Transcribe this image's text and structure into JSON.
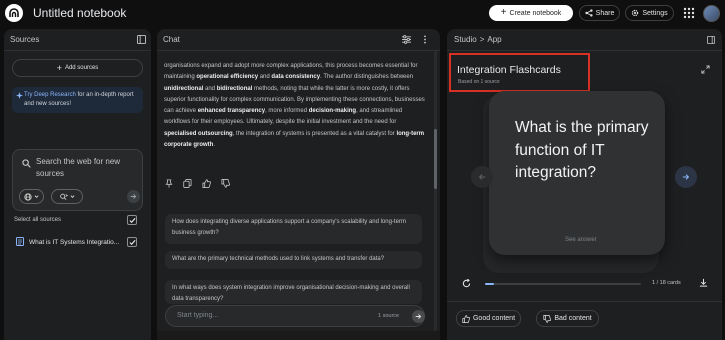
{
  "header": {
    "notebook_title": "Untitled notebook",
    "create_label": "Create notebook",
    "share_label": "Share",
    "settings_label": "Settings"
  },
  "sources": {
    "title": "Sources",
    "add_label": "Add sources",
    "deep_research_link": "Try Deep Research",
    "deep_research_text": " for an in-depth report and new sources!",
    "search_placeholder": "Search the web for new sources",
    "select_all_label": "Select all sources",
    "items": [
      {
        "label": "What is IT Systems Integratio...",
        "checked": true
      }
    ]
  },
  "chat": {
    "title": "Chat",
    "message": [
      {
        "text": "organisations expand and adopt more complex applications, this process becomes essential for maintaining ",
        "bold": false
      },
      {
        "text": "operational efficiency",
        "bold": true
      },
      {
        "text": " and ",
        "bold": false
      },
      {
        "text": "data consistency",
        "bold": true
      },
      {
        "text": ". The author distinguishes between ",
        "bold": false
      },
      {
        "text": "unidirectional",
        "bold": true
      },
      {
        "text": " and ",
        "bold": false
      },
      {
        "text": "bidirectional",
        "bold": true
      },
      {
        "text": " methods, noting that while the latter is more costly, it offers superior functionality for complex communication. By implementing these connections, businesses can achieve ",
        "bold": false
      },
      {
        "text": "enhanced transparency",
        "bold": true
      },
      {
        "text": ", more informed ",
        "bold": false
      },
      {
        "text": "decision-making",
        "bold": true
      },
      {
        "text": ", and streamlined workflows for their employees. Ultimately, despite the initial investment and the need for ",
        "bold": false
      },
      {
        "text": "specialised outsourcing",
        "bold": true
      },
      {
        "text": ", the integration of systems is presented as a vital catalyst for ",
        "bold": false
      },
      {
        "text": "long-term corporate growth",
        "bold": true
      },
      {
        "text": ".",
        "bold": false
      }
    ],
    "suggestions": [
      "How does integrating diverse applications support a company's scalability and long-term business growth?",
      "What are the primary technical methods used to link systems and transfer data?",
      "In what ways does system integration improve organisational decision-making and overall data transparency?"
    ],
    "input_placeholder": "Start typing...",
    "source_count": "1 source"
  },
  "studio": {
    "crumb_root": "Studio",
    "crumb_sep": ">",
    "crumb_leaf": "App",
    "flashcards_title": "Integration Flashcards",
    "based_on": "Based on 1 source",
    "question": "What is the primary function of IT integration?",
    "see_answer": "See answer",
    "progress_fraction": 0.0556,
    "card_count": "1 / 18 cards",
    "good_label": "Good content",
    "bad_label": "Bad content"
  },
  "colors": {
    "background": "#0f0f10",
    "panel": "#1e1f20",
    "accent_blue": "#8ab4f8",
    "highlight_red": "#d93025"
  }
}
